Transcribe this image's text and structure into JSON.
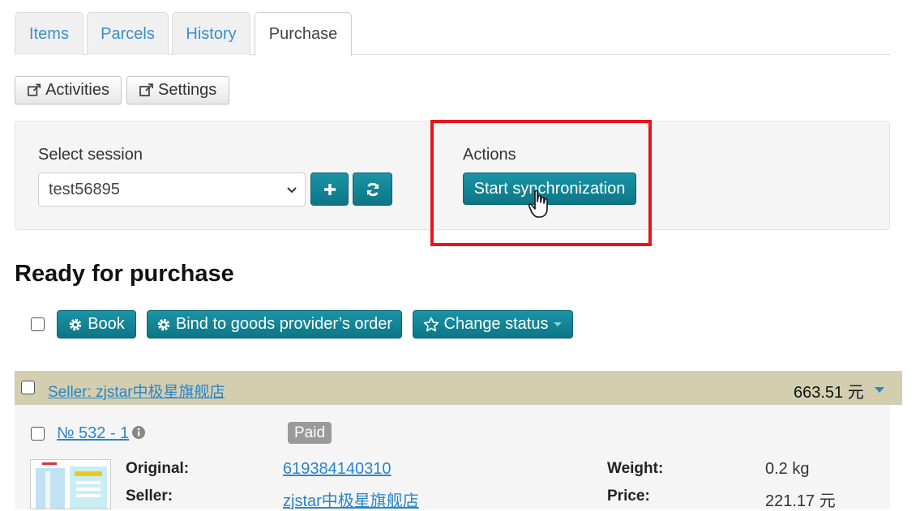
{
  "tabs": [
    {
      "label": "Items"
    },
    {
      "label": "Parcels"
    },
    {
      "label": "History"
    },
    {
      "label": "Purchase",
      "active": true
    }
  ],
  "toolbar": {
    "activities_label": "Activities",
    "settings_label": "Settings"
  },
  "session": {
    "label": "Select session",
    "selected": "test56895"
  },
  "actions": {
    "label": "Actions",
    "sync_button": "Start synchronization"
  },
  "section": {
    "title": "Ready for purchase"
  },
  "bulk_actions": {
    "book": "Book",
    "bind": "Bind to goods provider’s order",
    "change_status": "Change status"
  },
  "seller_group": {
    "seller_link": "Seller: zjstar中极星旗舰店",
    "total": "663.51 元"
  },
  "order": {
    "number": "№ 532 - 1",
    "status": "Paid",
    "original_label": "Original:",
    "original_value": "619384140310",
    "seller_label": "Seller:",
    "seller_value": "zjstar中极星旗舰店",
    "weight_label": "Weight:",
    "weight_value": "0.2 kg",
    "price_label": "Price:",
    "price_value": "221.17 元"
  },
  "colors": {
    "accent": "#0d7686",
    "link": "#2a86c8",
    "highlight": "#e8141a",
    "seller_bar": "#d3ceb0"
  }
}
